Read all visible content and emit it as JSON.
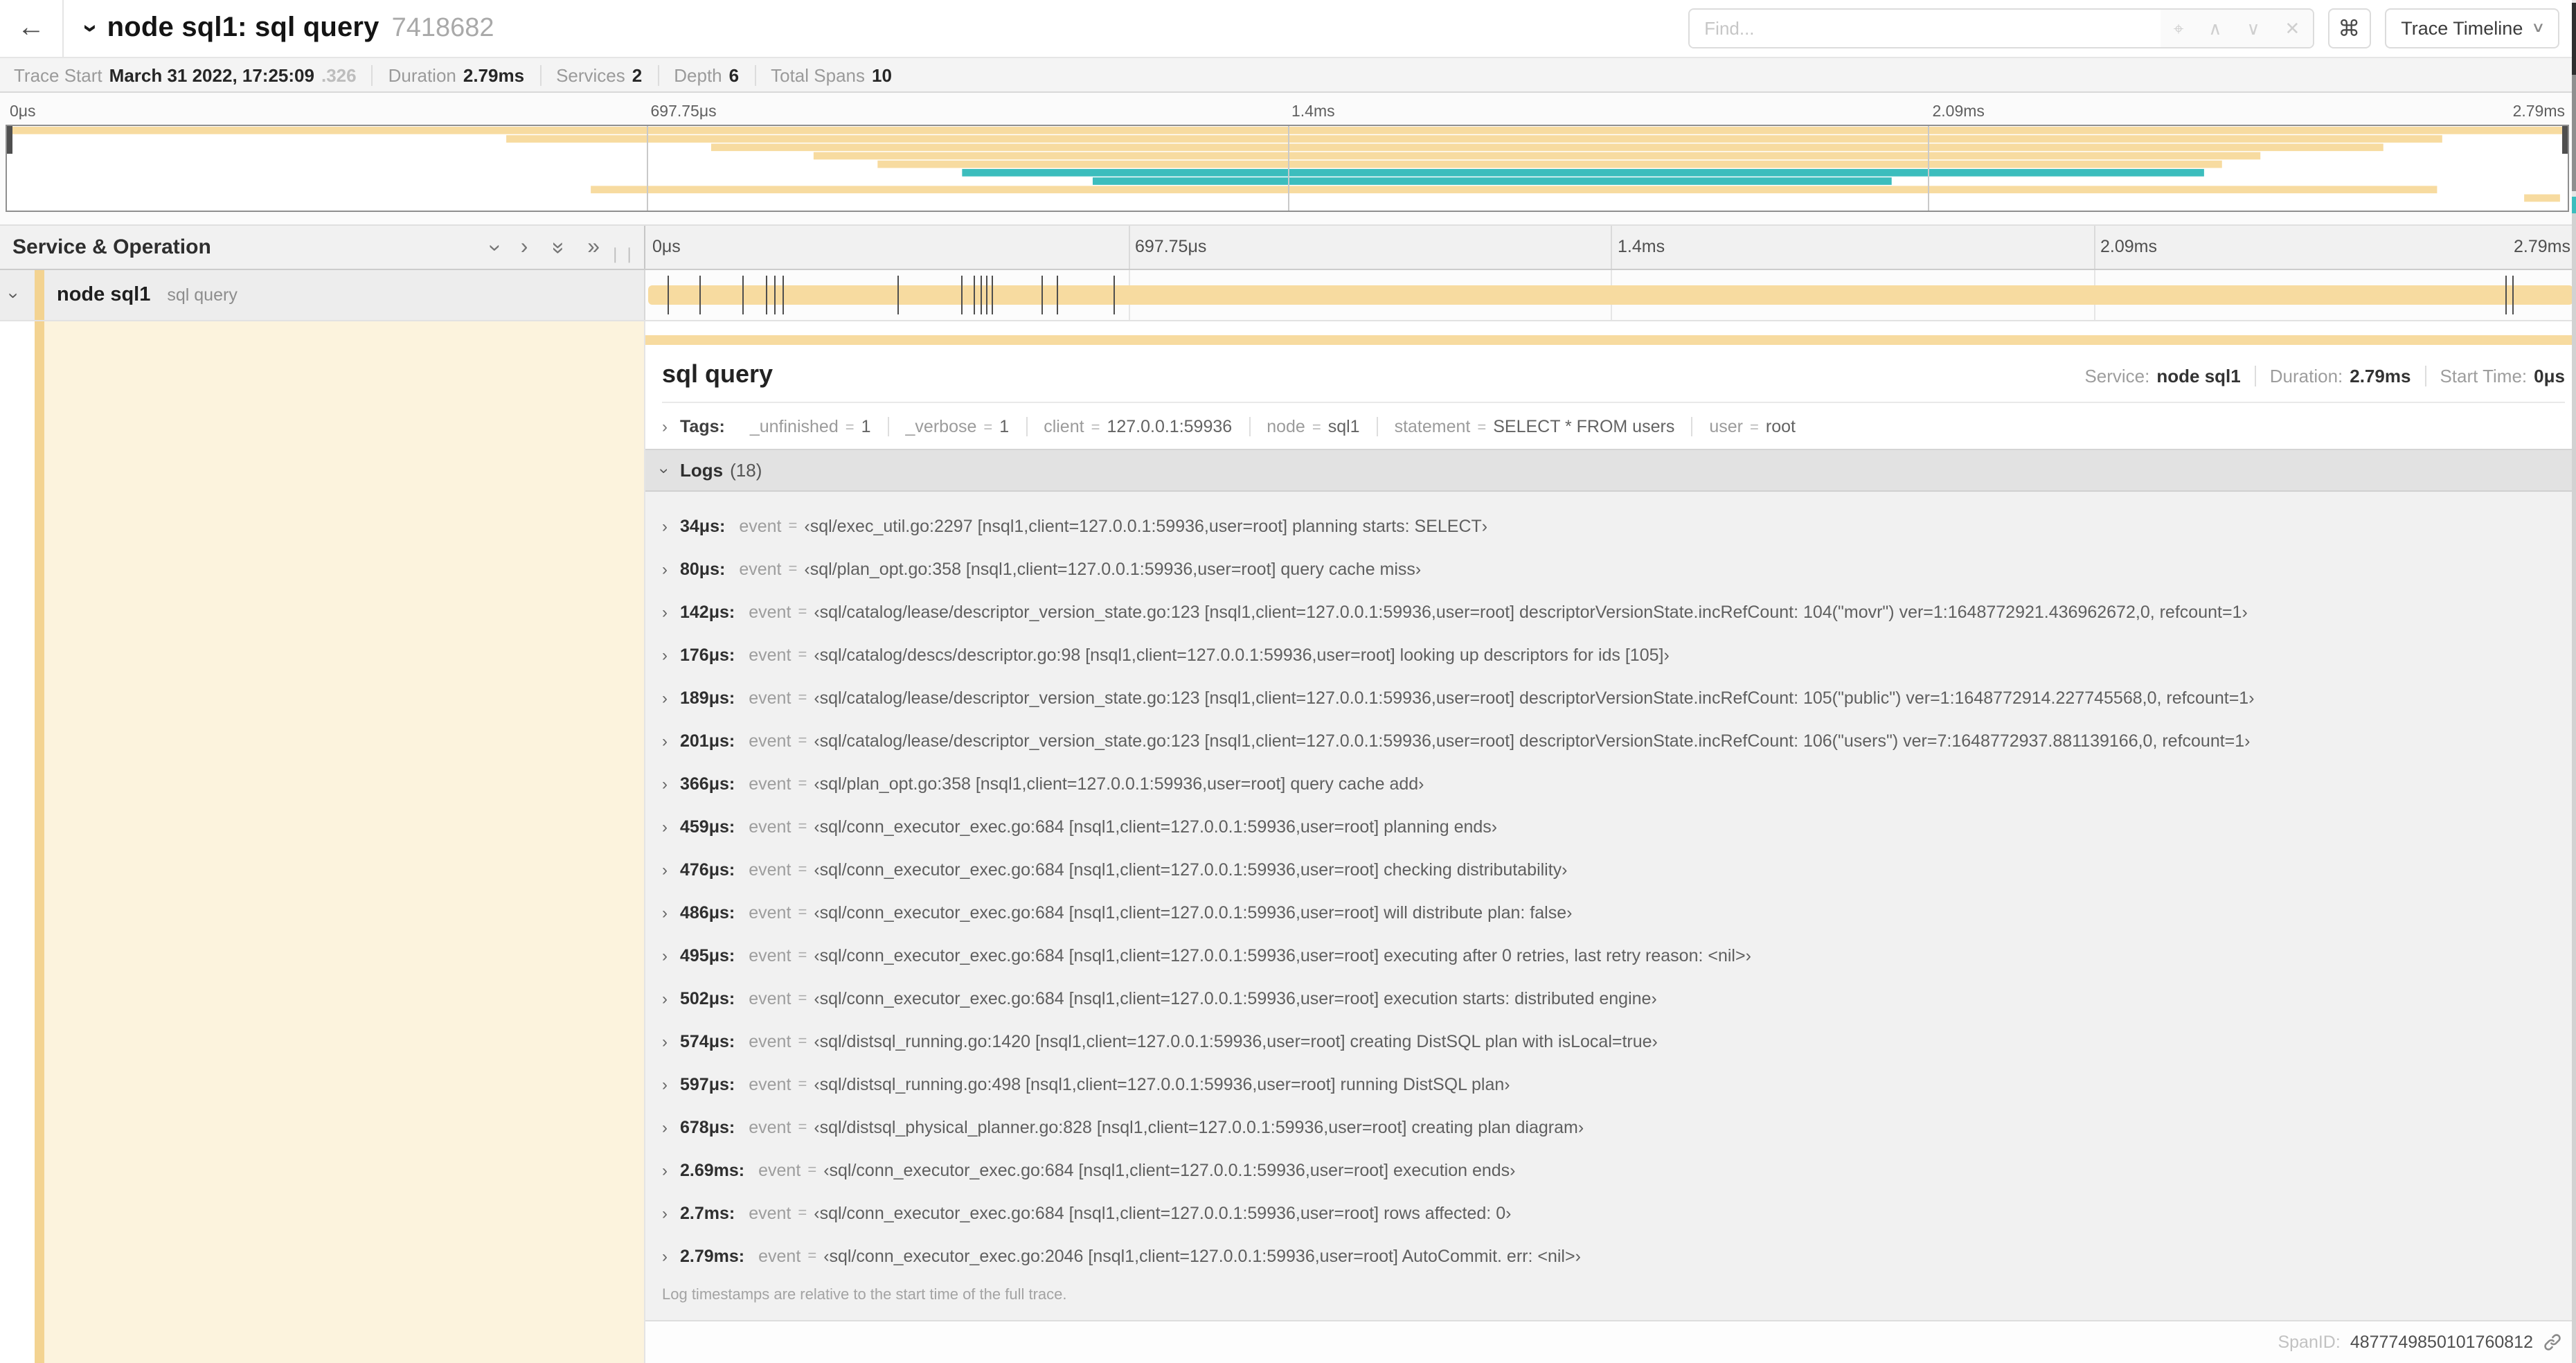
{
  "header": {
    "back": "←",
    "expander": "›",
    "title": "node sql1: sql query",
    "trace_id": "7418682",
    "find_placeholder": "Find...",
    "find_buttons": [
      "⌖",
      "∧",
      "∨",
      "✕"
    ],
    "shortcut_key": "⌘",
    "view_selector": "Trace Timeline"
  },
  "summary": {
    "items": [
      {
        "label": "Trace Start",
        "value": "March 31 2022, 17:25:09",
        "suffix": ".326"
      },
      {
        "label": "Duration",
        "value": "2.79ms"
      },
      {
        "label": "Services",
        "value": "2"
      },
      {
        "label": "Depth",
        "value": "6"
      },
      {
        "label": "Total Spans",
        "value": "10"
      }
    ]
  },
  "timeline": {
    "ticks": [
      "0μs",
      "697.75μs",
      "1.4ms",
      "2.09ms",
      "2.79ms"
    ],
    "left_header": "Service & Operation",
    "colors": {
      "yellow": "#f7dba0",
      "teal": "#3cbdbd"
    },
    "minimap_rows": [
      {
        "start": 0,
        "end": 100,
        "color": "yellow"
      },
      {
        "start": 19.5,
        "end": 95.1,
        "color": "yellow"
      },
      {
        "start": 27.5,
        "end": 92.8,
        "color": "yellow"
      },
      {
        "start": 31.5,
        "end": 88.0,
        "color": "yellow"
      },
      {
        "start": 34.0,
        "end": 86.5,
        "color": "yellow"
      },
      {
        "start": 37.3,
        "end": 85.8,
        "color": "teal"
      },
      {
        "start": 42.4,
        "end": 73.6,
        "color": "teal"
      },
      {
        "start": 22.8,
        "end": 94.9,
        "color": "yellow"
      },
      {
        "start": 98.3,
        "end": 99.7,
        "color": "yellow"
      }
    ],
    "span": {
      "service": "node sql1",
      "operation": "sql query",
      "log_marker_pcts": [
        1.22,
        2.87,
        5.09,
        6.31,
        6.77,
        7.2,
        13.12,
        16.45,
        17.06,
        17.42,
        17.74,
        18.0,
        20.57,
        21.4,
        24.3,
        96.42,
        96.77,
        100
      ]
    }
  },
  "detail": {
    "title": "sql query",
    "meta": [
      {
        "label": "Service:",
        "value": "node sql1"
      },
      {
        "label": "Duration:",
        "value": "2.79ms"
      },
      {
        "label": "Start Time:",
        "value": "0μs"
      }
    ],
    "tags_label": "Tags:",
    "tags": [
      {
        "key": "_unfinished",
        "value": "1"
      },
      {
        "key": "_verbose",
        "value": "1"
      },
      {
        "key": "client",
        "value": "127.0.0.1:59936"
      },
      {
        "key": "node",
        "value": "sql1"
      },
      {
        "key": "statement",
        "value": "SELECT * FROM users"
      },
      {
        "key": "user",
        "value": "root"
      }
    ],
    "logs_label": "Logs",
    "logs_count": "(18)",
    "logs": [
      {
        "time": "34μs:",
        "key": "event",
        "value": "‹sql/exec_util.go:2297 [nsql1,client=127.0.0.1:59936,user=root] planning starts: SELECT›"
      },
      {
        "time": "80μs:",
        "key": "event",
        "value": "‹sql/plan_opt.go:358 [nsql1,client=127.0.0.1:59936,user=root] query cache miss›"
      },
      {
        "time": "142μs:",
        "key": "event",
        "value": "‹sql/catalog/lease/descriptor_version_state.go:123 [nsql1,client=127.0.0.1:59936,user=root] descriptorVersionState.incRefCount: 104(\"movr\") ver=1:1648772921.436962672,0, refcount=1›"
      },
      {
        "time": "176μs:",
        "key": "event",
        "value": "‹sql/catalog/descs/descriptor.go:98 [nsql1,client=127.0.0.1:59936,user=root] looking up descriptors for ids [105]›"
      },
      {
        "time": "189μs:",
        "key": "event",
        "value": "‹sql/catalog/lease/descriptor_version_state.go:123 [nsql1,client=127.0.0.1:59936,user=root] descriptorVersionState.incRefCount: 105(\"public\") ver=1:1648772914.227745568,0, refcount=1›"
      },
      {
        "time": "201μs:",
        "key": "event",
        "value": "‹sql/catalog/lease/descriptor_version_state.go:123 [nsql1,client=127.0.0.1:59936,user=root] descriptorVersionState.incRefCount: 106(\"users\") ver=7:1648772937.881139166,0, refcount=1›"
      },
      {
        "time": "366μs:",
        "key": "event",
        "value": "‹sql/plan_opt.go:358 [nsql1,client=127.0.0.1:59936,user=root] query cache add›"
      },
      {
        "time": "459μs:",
        "key": "event",
        "value": "‹sql/conn_executor_exec.go:684 [nsql1,client=127.0.0.1:59936,user=root] planning ends›"
      },
      {
        "time": "476μs:",
        "key": "event",
        "value": "‹sql/conn_executor_exec.go:684 [nsql1,client=127.0.0.1:59936,user=root] checking distributability›"
      },
      {
        "time": "486μs:",
        "key": "event",
        "value": "‹sql/conn_executor_exec.go:684 [nsql1,client=127.0.0.1:59936,user=root] will distribute plan: false›"
      },
      {
        "time": "495μs:",
        "key": "event",
        "value": "‹sql/conn_executor_exec.go:684 [nsql1,client=127.0.0.1:59936,user=root] executing after 0 retries, last retry reason: <nil>›"
      },
      {
        "time": "502μs:",
        "key": "event",
        "value": "‹sql/conn_executor_exec.go:684 [nsql1,client=127.0.0.1:59936,user=root] execution starts: distributed engine›"
      },
      {
        "time": "574μs:",
        "key": "event",
        "value": "‹sql/distsql_running.go:1420 [nsql1,client=127.0.0.1:59936,user=root] creating DistSQL plan with isLocal=true›"
      },
      {
        "time": "597μs:",
        "key": "event",
        "value": "‹sql/distsql_running.go:498 [nsql1,client=127.0.0.1:59936,user=root] running DistSQL plan›"
      },
      {
        "time": "678μs:",
        "key": "event",
        "value": "‹sql/distsql_physical_planner.go:828 [nsql1,client=127.0.0.1:59936,user=root] creating plan diagram›"
      },
      {
        "time": "2.69ms:",
        "key": "event",
        "value": "‹sql/conn_executor_exec.go:684 [nsql1,client=127.0.0.1:59936,user=root] execution ends›"
      },
      {
        "time": "2.7ms:",
        "key": "event",
        "value": "‹sql/conn_executor_exec.go:684 [nsql1,client=127.0.0.1:59936,user=root] rows affected: 0›"
      },
      {
        "time": "2.79ms:",
        "key": "event",
        "value": "‹sql/conn_executor_exec.go:2046 [nsql1,client=127.0.0.1:59936,user=root] AutoCommit. err: <nil>›"
      }
    ],
    "logs_footnote": "Log timestamps are relative to the start time of the full trace.",
    "span_id_label": "SpanID:",
    "span_id": "4877749850101760812"
  }
}
